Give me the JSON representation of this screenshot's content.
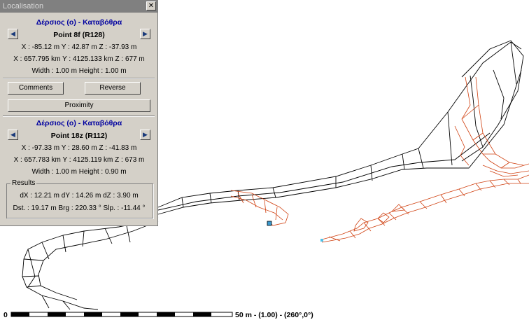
{
  "window": {
    "title": "Localisation",
    "close_glyph": "✕"
  },
  "icons": {
    "prev": "arrow-left-icon",
    "next": "arrow-right-icon",
    "close": "close-icon"
  },
  "point1": {
    "cave_name": "Δέρσιος (ο) - Καταβόθρα",
    "point_name": "Point 8f (R128)",
    "local_coords": "X : -85.12 m Y : 42.87 m Z : -37.93 m",
    "world_coords": "X : 657.795 km Y : 4125.133 km Z : 677 m",
    "size": "Width : 1.00 m  Height : 1.00 m"
  },
  "buttons": {
    "comments": "Comments",
    "reverse": "Reverse",
    "proximity": "Proximity"
  },
  "point2": {
    "cave_name": "Δέρσιος (ο) - Καταβόθρα",
    "point_name": "Point 18z (R112)",
    "local_coords": "X : -97.33 m Y : 28.60 m Z : -41.83 m",
    "world_coords": "X : 657.783 km Y : 4125.119 km Z : 673 m",
    "size": "Width : 1.00 m  Height : 0.90 m"
  },
  "results": {
    "label": "Results",
    "delta": "dX : 12.21 m dY : 14.26 m dZ : 3.90 m",
    "distance": "Dst. : 19.17 m Brg : 220.33 ° Slp. : -11.44 °"
  },
  "scale": {
    "zero_label": "0",
    "end_label": "50 m - (1.00) - (260°,0°)"
  },
  "colors": {
    "panel_bg": "#d4d0c8",
    "titlebar_bg": "#808080",
    "cave_text": "#0000a0",
    "survey_red": "#d04010",
    "survey_black": "#000000"
  }
}
